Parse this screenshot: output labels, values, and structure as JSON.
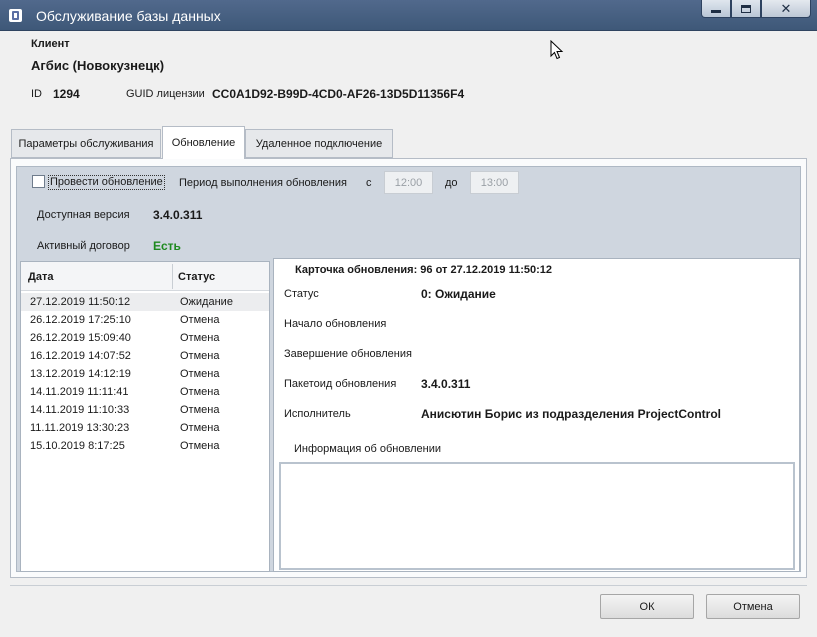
{
  "window": {
    "title": "Обслуживание базы данных",
    "minimize": "—",
    "maximize": "□",
    "close": "✕"
  },
  "client": {
    "label": "Клиент",
    "name": "Агбис (Новокузнецк)",
    "id_label": "ID",
    "id_value": "1294",
    "guid_label": "GUID лицензии",
    "guid_value": "CC0A1D92-B99D-4CD0-AF26-13D5D11356F4"
  },
  "tabs": [
    {
      "label": "Параметры обслуживания"
    },
    {
      "label": "Обновление",
      "active": true
    },
    {
      "label": "Удаленное подключение"
    }
  ],
  "update": {
    "do_update_label": "Провести обновление",
    "do_update_checked": false,
    "period_label": "Период выполнения обновления",
    "from_label": "с",
    "from_value": "12:00",
    "to_label": "до",
    "to_value": "13:00",
    "version_label": "Доступная версия",
    "version_value": "3.4.0.311",
    "contract_label": "Активный договор",
    "contract_value": "Есть"
  },
  "history": {
    "headers": {
      "date": "Дата",
      "status": "Статус"
    },
    "rows": [
      {
        "date": "27.12.2019 11:50:12",
        "status": "Ожидание"
      },
      {
        "date": "26.12.2019 17:25:10",
        "status": "Отмена"
      },
      {
        "date": "26.12.2019 15:09:40",
        "status": "Отмена"
      },
      {
        "date": "16.12.2019 14:07:52",
        "status": "Отмена"
      },
      {
        "date": "13.12.2019 14:12:19",
        "status": "Отмена"
      },
      {
        "date": "14.11.2019 11:11:41",
        "status": "Отмена"
      },
      {
        "date": "14.11.2019 11:10:33",
        "status": "Отмена"
      },
      {
        "date": "11.11.2019 13:30:23",
        "status": "Отмена"
      },
      {
        "date": "15.10.2019 8:17:25",
        "status": "Отмена"
      }
    ]
  },
  "card": {
    "title": "Карточка обновления:  96  от  27.12.2019 11:50:12",
    "status_label": "Статус",
    "status_value": "0: Ожидание",
    "start_label": "Начало обновления",
    "start_value": "",
    "end_label": "Завершение обновления",
    "end_value": "",
    "package_label": "Пакетоид обновления",
    "package_value": "3.4.0.311",
    "executor_label": "Исполнитель",
    "executor_value": "Анисютин Борис  из подразделения ProjectControl",
    "info_label": "Информация об обновлении",
    "info_value": ""
  },
  "buttons": {
    "ok": "ОК",
    "cancel": "Отмена"
  },
  "colors": {
    "titlebar": "#4a6387",
    "accent_green": "#1f8a1f",
    "panel_bg": "#cfd6df"
  }
}
